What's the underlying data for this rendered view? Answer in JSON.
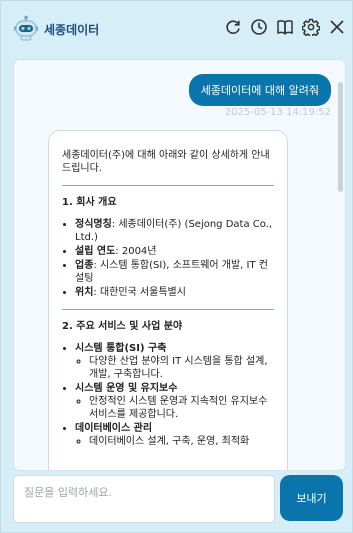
{
  "app": {
    "title": "세종데이터"
  },
  "header": {
    "icons": [
      "refresh-icon",
      "history-clock-icon",
      "book-icon",
      "gear-icon",
      "close-icon"
    ]
  },
  "conversation": {
    "user_message": "세종데이터에 대해 알려줘",
    "timestamp": "2025-05-13 14:19:52",
    "bot": {
      "intro": "세종데이터(주)에 대해 아래와 같이 상세하게 안내드립니다.",
      "sections": [
        {
          "title": "1. 회사 개요",
          "items": [
            {
              "label": "정식명칭",
              "text": ": 세종데이터(주) (Sejong Data Co., Ltd.)"
            },
            {
              "label": "설립 연도",
              "text": ": 2004년"
            },
            {
              "label": "업종",
              "text": ": 시스템 통합(SI), 소프트웨어 개발, IT 컨설팅"
            },
            {
              "label": "위치",
              "text": ": 대한민국 서울특별시"
            }
          ]
        },
        {
          "title": "2. 주요 서비스 및 사업 분야",
          "items": [
            {
              "label": "시스템 통합(SI) 구축",
              "sub": "다양한 산업 분야의 IT 시스템을 통합 설계, 개발, 구축합니다."
            },
            {
              "label": "시스템 운영 및 유지보수",
              "sub": "안정적인 시스템 운영과 지속적인 유지보수 서비스를 제공합니다."
            },
            {
              "label": "데이터베이스 관리",
              "sub": "데이터베이스 설계, 구축, 운영, 최적화"
            }
          ]
        }
      ]
    }
  },
  "input": {
    "placeholder": "질문을 입력하세요.",
    "value": ""
  },
  "send_button": {
    "label": "보내기"
  },
  "colors": {
    "accent": "#0a74ad",
    "window_bg": "#d6eef8",
    "title": "#1f4e79"
  }
}
